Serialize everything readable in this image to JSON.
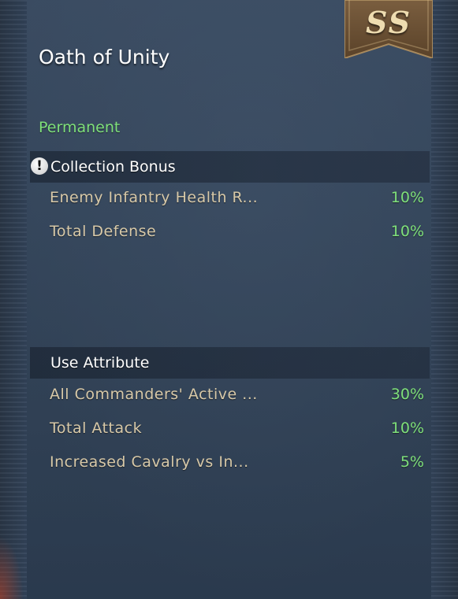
{
  "item": {
    "title": "Oath of Unity",
    "rank": "SS",
    "duration": "Permanent"
  },
  "collection_bonus": {
    "header": "Collection Bonus",
    "icon": "exclamation-icon",
    "rows": [
      {
        "label": "Enemy Infantry Health R...",
        "value": "10%"
      },
      {
        "label": "Total Defense",
        "value": "10%"
      }
    ]
  },
  "use_attribute": {
    "header": "Use Attribute",
    "rows": [
      {
        "label": "All Commanders' Active ...",
        "value": "30%"
      },
      {
        "label": "Total Attack",
        "value": "10%"
      },
      {
        "label": "Increased Cavalry vs In...",
        "value": "5%"
      }
    ]
  },
  "colors": {
    "value_green": "#7fe07a",
    "label_tan": "#d8c9a8",
    "panel_blue": "#34465b",
    "badge_brown": "#6b5237"
  }
}
